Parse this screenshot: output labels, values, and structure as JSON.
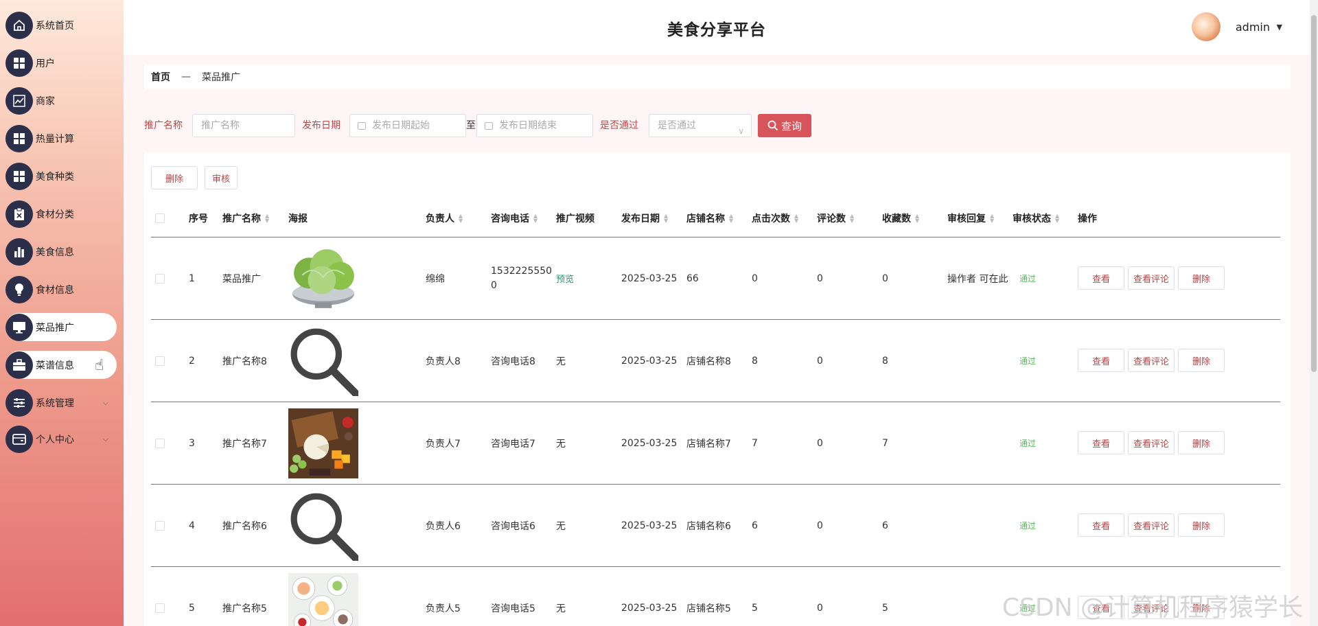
{
  "app": {
    "title": "美食分享平台",
    "user": "admin"
  },
  "sidebar": {
    "items": [
      {
        "label": "系统首页",
        "icon": "home-icon"
      },
      {
        "label": "用户",
        "icon": "grid-icon"
      },
      {
        "label": "商家",
        "icon": "chart-line-icon"
      },
      {
        "label": "热量计算",
        "icon": "grid-icon"
      },
      {
        "label": "美食种类",
        "icon": "grid-icon"
      },
      {
        "label": "食材分类",
        "icon": "clipboard-icon"
      },
      {
        "label": "美食信息",
        "icon": "bar-chart-icon"
      },
      {
        "label": "食材信息",
        "icon": "bulb-icon"
      },
      {
        "label": "菜品推广",
        "icon": "monitor-icon",
        "active": true
      },
      {
        "label": "菜谱信息",
        "icon": "briefcase-icon",
        "hover": true
      },
      {
        "label": "系统管理",
        "icon": "sliders-icon",
        "expandable": true
      },
      {
        "label": "个人中心",
        "icon": "wallet-icon",
        "expandable": true
      }
    ]
  },
  "breadcrumb": {
    "home": "首页",
    "separator": "—",
    "current": "菜品推广"
  },
  "search": {
    "name_label": "推广名称",
    "name_placeholder": "推广名称",
    "date_label": "发布日期",
    "date_start_placeholder": "发布日期起始",
    "date_to": "至",
    "date_end_placeholder": "发布日期结束",
    "pass_label": "是否通过",
    "pass_placeholder": "是否通过",
    "query_button": "查询"
  },
  "actions": {
    "delete": "删除",
    "audit": "审核"
  },
  "table": {
    "headers": {
      "index": "序号",
      "name": "推广名称",
      "poster": "海报",
      "owner": "负责人",
      "phone": "咨询电话",
      "video": "推广视频",
      "date": "发布日期",
      "shop": "店铺名称",
      "clicks": "点击次数",
      "comments": "评论数",
      "favorites": "收藏数",
      "reply": "审核回复",
      "status": "审核状态",
      "ops": "操作"
    },
    "row_buttons": {
      "view": "查看",
      "view_comments": "查看评论",
      "delete": "删除"
    },
    "rows": [
      {
        "index": "1",
        "name": "菜品推广",
        "poster": "lettuce",
        "owner": "绵绵",
        "phone_l1": "1532225550",
        "phone_l2": "0",
        "video": "预览",
        "date": "2025-03-25",
        "shop": "66",
        "clicks": "0",
        "comments": "0",
        "favorites": "0",
        "reply": "操作者 可在此",
        "status": "通过"
      },
      {
        "index": "2",
        "name": "推广名称8",
        "poster": "search",
        "owner": "负责人8",
        "phone_l1": "咨询电话8",
        "phone_l2": "",
        "video": "无",
        "date": "2025-03-25",
        "shop": "店铺名称8",
        "clicks": "8",
        "comments": "0",
        "favorites": "8",
        "reply": "",
        "status": "通过"
      },
      {
        "index": "3",
        "name": "推广名称7",
        "poster": "cheese",
        "owner": "负责人7",
        "phone_l1": "咨询电话7",
        "phone_l2": "",
        "video": "无",
        "date": "2025-03-25",
        "shop": "店铺名称7",
        "clicks": "7",
        "comments": "0",
        "favorites": "7",
        "reply": "",
        "status": "通过"
      },
      {
        "index": "4",
        "name": "推广名称6",
        "poster": "search",
        "owner": "负责人6",
        "phone_l1": "咨询电话6",
        "phone_l2": "",
        "video": "无",
        "date": "2025-03-25",
        "shop": "店铺名称6",
        "clicks": "6",
        "comments": "0",
        "favorites": "6",
        "reply": "",
        "status": "通过"
      },
      {
        "index": "5",
        "name": "推广名称5",
        "poster": "table",
        "owner": "负责人5",
        "phone_l1": "咨询电话5",
        "phone_l2": "",
        "video": "无",
        "date": "2025-03-25",
        "shop": "店铺名称5",
        "clicks": "5",
        "comments": "0",
        "favorites": "5",
        "reply": "",
        "status": "通过"
      }
    ]
  },
  "watermark": "CSDN @计算机程序猿学长",
  "colors": {
    "accent": "#d8545b",
    "active_text": "#c04848",
    "status_green": "#5cb85c",
    "sidebar_icon_bg": "#2c2f4a"
  }
}
